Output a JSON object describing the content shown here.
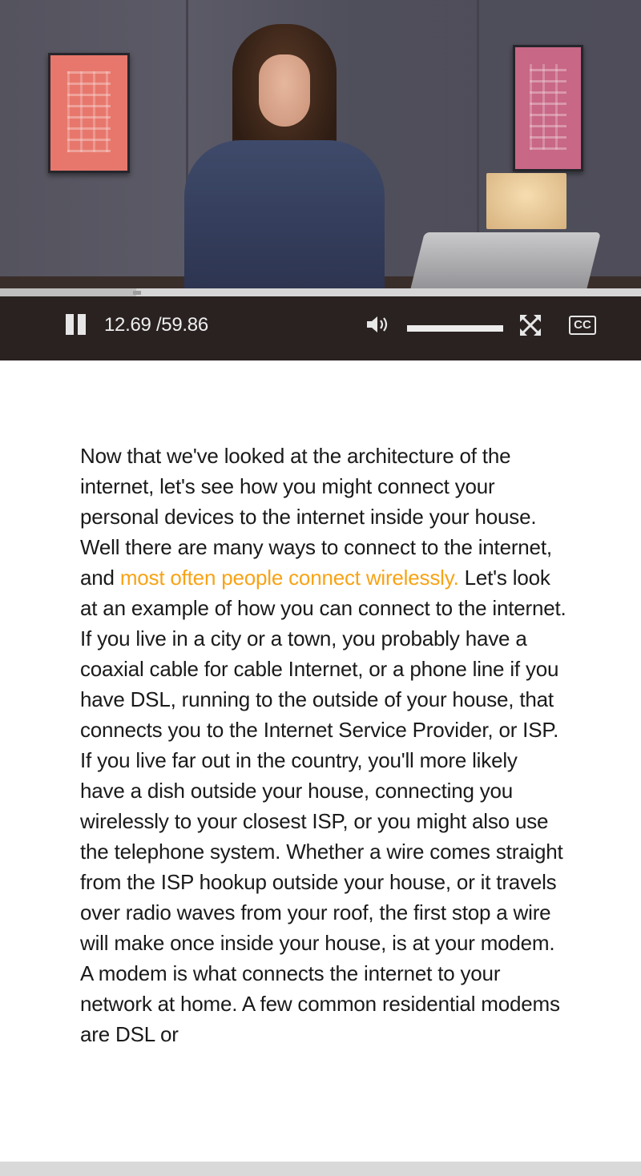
{
  "player": {
    "current_time": "12.69",
    "duration": "/59.86",
    "progress": 0.212,
    "volume": 1.0,
    "captions_label": "CC",
    "icons": {
      "play_state": "pause-icon",
      "volume": "volume-icon",
      "fullscreen": "fullscreen-icon",
      "captions": "cc-icon"
    }
  },
  "transcript": {
    "text_before": "Now that we've looked at the architecture of the internet, let's see how you might connect your personal devices to the internet inside your house. Well there are many ways to connect to the internet, and ",
    "highlighted": "most often people connect wirelessly.",
    "text_after": " Let's look at an example of how you can connect to the internet. If you live in a city or a town, you probably have a coaxial cable for cable Internet, or a phone line if you have DSL, running to the outside of your house, that connects you to the Internet Service Provider, or ISP. If you live far out in the country, you'll more likely have a dish outside your house, connecting you wirelessly to your closest ISP, or you might also use the telephone system. Whether a wire comes straight from the ISP hookup outside your house, or it travels over radio waves from your roof, the first stop a wire will make once inside your house, is at your modem. A modem is what connects the internet to your network at home. A few common residential modems are DSL or",
    "highlight_color": "#f7a316"
  }
}
